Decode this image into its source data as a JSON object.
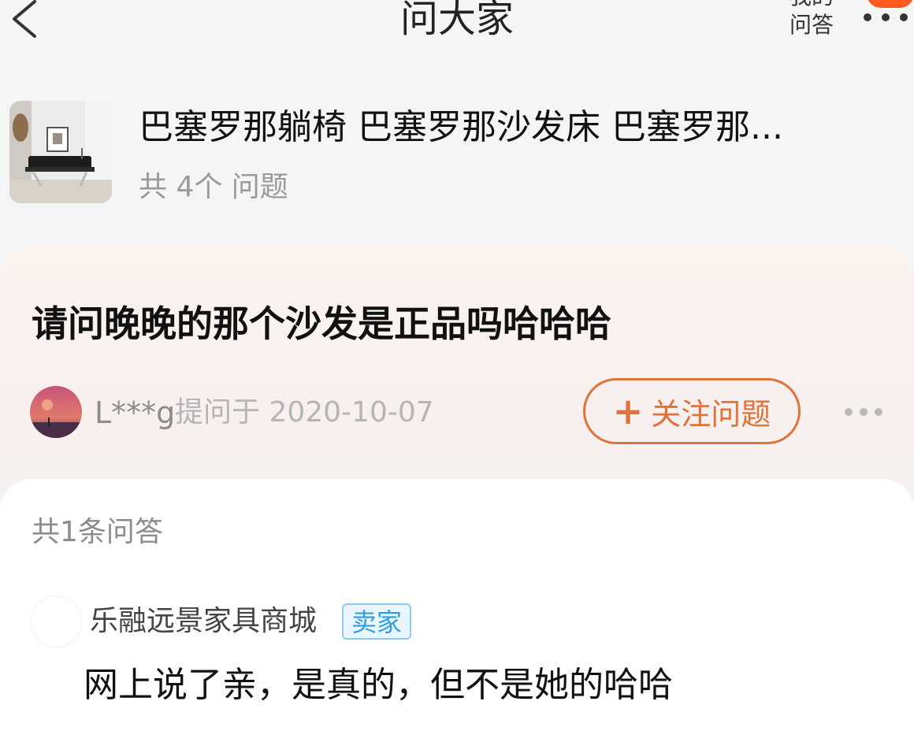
{
  "nav": {
    "title": "问大家",
    "my_qa_label": "我的\n问答"
  },
  "product": {
    "title": "巴塞罗那躺椅 巴塞罗那沙发床 巴塞罗那...",
    "question_count": "共 4个 问题"
  },
  "question": {
    "text": "请问晚晚的那个沙发是正品吗哈哈哈",
    "asker": "L***g",
    "asked_at": "提问于 2020-10-07",
    "follow_label": "关注问题",
    "follow_icon": "plus-icon"
  },
  "answers": {
    "count_label": "共1条问答",
    "items": [
      {
        "author": "乐融远景家具商城",
        "badge": "卖家",
        "text": "网上说了亲，是真的，但不是她的哈哈"
      }
    ]
  },
  "colors": {
    "accent": "#e0733a",
    "notify_badge": "#ff5a1f",
    "seller_badge_text": "#2e9ee6",
    "seller_badge_border": "#8ccaf0",
    "page_bg": "#f5f5f5"
  }
}
